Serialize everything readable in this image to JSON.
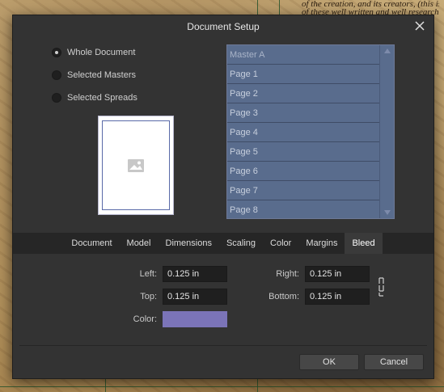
{
  "background": {
    "text": [
      "of the creation, and its creators, (this is...",
      "of these well written and well researched"
    ]
  },
  "dialog": {
    "title": "Document Setup",
    "close_icon": "close-icon"
  },
  "scope": {
    "options": [
      {
        "label": "Whole Document",
        "selected": true
      },
      {
        "label": "Selected Masters",
        "selected": false
      },
      {
        "label": "Selected Spreads",
        "selected": false
      }
    ]
  },
  "preview": {
    "icon": "image-placeholder-icon"
  },
  "pages": {
    "items": [
      "Master A",
      "Page 1",
      "Page 2",
      "Page 3",
      "Page 4",
      "Page 5",
      "Page 6",
      "Page 7",
      "Page 8"
    ]
  },
  "tabs": {
    "items": [
      "Document",
      "Model",
      "Dimensions",
      "Scaling",
      "Color",
      "Margins",
      "Bleed"
    ],
    "active": "Bleed"
  },
  "bleed": {
    "left_label": "Left:",
    "left_value": "0.125 in",
    "top_label": "Top:",
    "top_value": "0.125 in",
    "right_label": "Right:",
    "right_value": "0.125 in",
    "bottom_label": "Bottom:",
    "bottom_value": "0.125 in",
    "color_label": "Color:",
    "color_value": "#7b74b8",
    "link_icon": "chain-link-icon"
  },
  "buttons": {
    "ok": "OK",
    "cancel": "Cancel"
  },
  "colors": {
    "dialog_bg": "#333333",
    "list_item": "#596c8d",
    "tabbar": "#262626"
  }
}
